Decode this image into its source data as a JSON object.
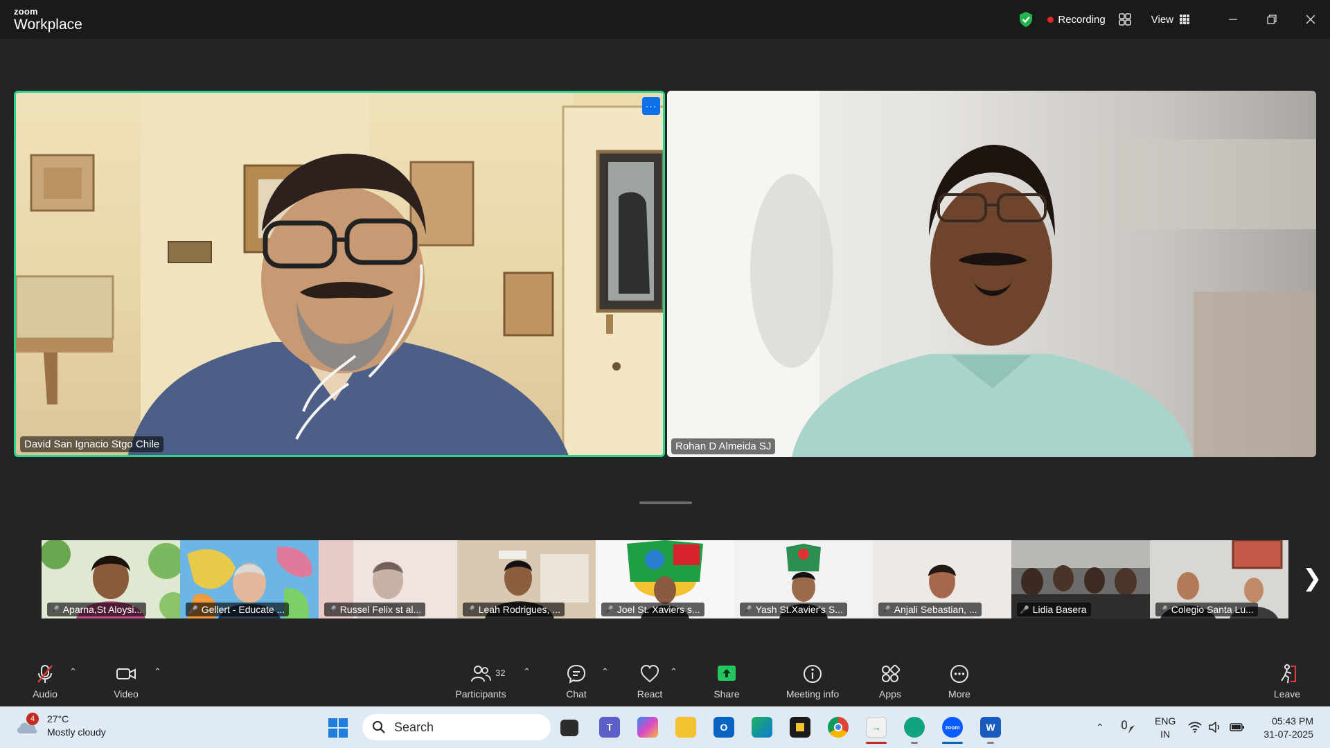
{
  "app": {
    "brand_small": "zoom",
    "brand_big": "Workplace"
  },
  "titlebar": {
    "recording_label": "Recording",
    "view_label": "View"
  },
  "videos": [
    {
      "name": "David  San Ignacio Stgo Chile",
      "active_speaker": true
    },
    {
      "name": "Rohan D Almeida SJ",
      "active_speaker": false
    }
  ],
  "participants_strip": [
    {
      "name": "Aparna,St Aloysi..."
    },
    {
      "name": "Gellert - Educate ..."
    },
    {
      "name": "Russel Felix st al..."
    },
    {
      "name": "Leah Rodrigues, ..."
    },
    {
      "name": "Joel  St. Xaviers s..."
    },
    {
      "name": "Yash St.Xavier's S..."
    },
    {
      "name": "Anjali Sebastian, ..."
    },
    {
      "name": "Lidia Basera"
    },
    {
      "name": "Colegio Santa Lu..."
    }
  ],
  "toolbar": {
    "audio": "Audio",
    "video": "Video",
    "participants": "Participants",
    "participants_count": "32",
    "chat": "Chat",
    "react": "React",
    "share": "Share",
    "meeting_info": "Meeting info",
    "apps": "Apps",
    "more": "More",
    "leave": "Leave"
  },
  "taskbar": {
    "weather_temp": "27°C",
    "weather_desc": "Mostly cloudy",
    "weather_badge": "4",
    "search_label": "Search",
    "lang_top": "ENG",
    "lang_bottom": "IN",
    "time": "05:43 PM",
    "date": "31-07-2025"
  },
  "colors": {
    "active_speaker_border": "#2ad48c",
    "recording_dot": "#e02828",
    "share_green": "#22c55e",
    "muted_red": "#e13b3b",
    "zoom_blue": "#0e71eb"
  }
}
